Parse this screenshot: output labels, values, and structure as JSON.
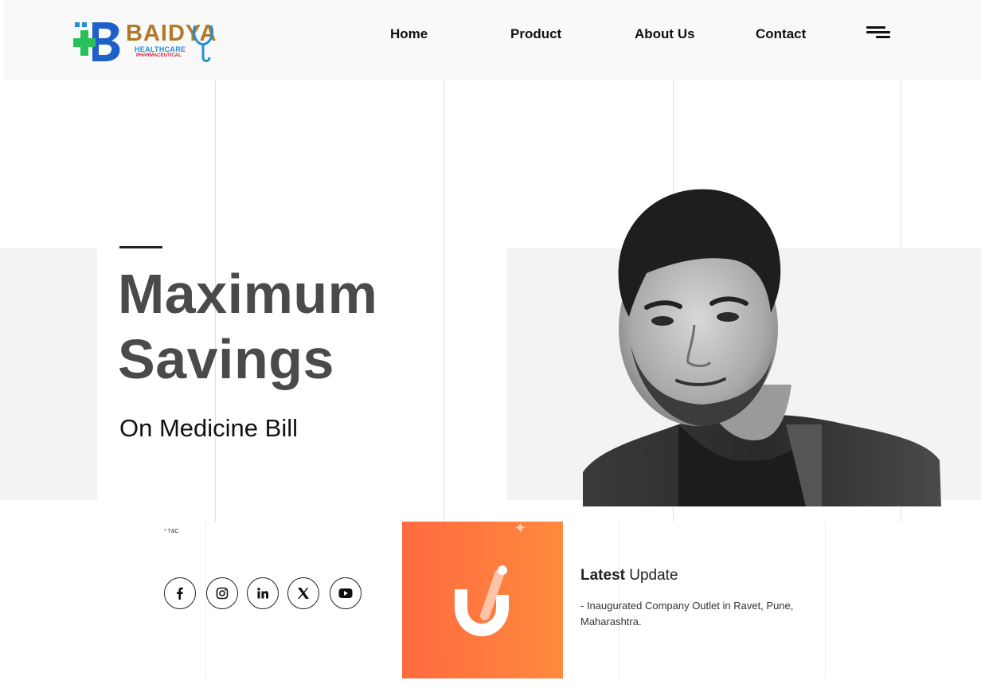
{
  "brand": {
    "name": "BAIDYA",
    "tagline": "HEALTHCARE",
    "subtagline": "PHARMACEUTICAL",
    "colors": {
      "gold": "#b07a2a",
      "blue": "#1f8fd6",
      "green": "#27c05a",
      "red": "#d0203a"
    }
  },
  "nav": {
    "items": [
      "Home",
      "Product",
      "About Us",
      "Contact"
    ],
    "menu_icon": "hamburger-icon"
  },
  "hero": {
    "title_line1": "Maximum",
    "title_line2": "Savings",
    "subtitle": "On Medicine Bill",
    "portrait_icon": "person-portrait"
  },
  "footer": {
    "tc": "* T&C",
    "socials": [
      "facebook-icon",
      "instagram-icon",
      "linkedin-icon",
      "x-icon",
      "youtube-icon"
    ],
    "promo_colors": {
      "start": "#ff6a40",
      "end": "#ff8a3d"
    },
    "update": {
      "title_bold": "Latest",
      "title_rest": " Update",
      "body": "- Inaugurated Company Outlet in Ravet, Pune, Maharashtra."
    }
  }
}
